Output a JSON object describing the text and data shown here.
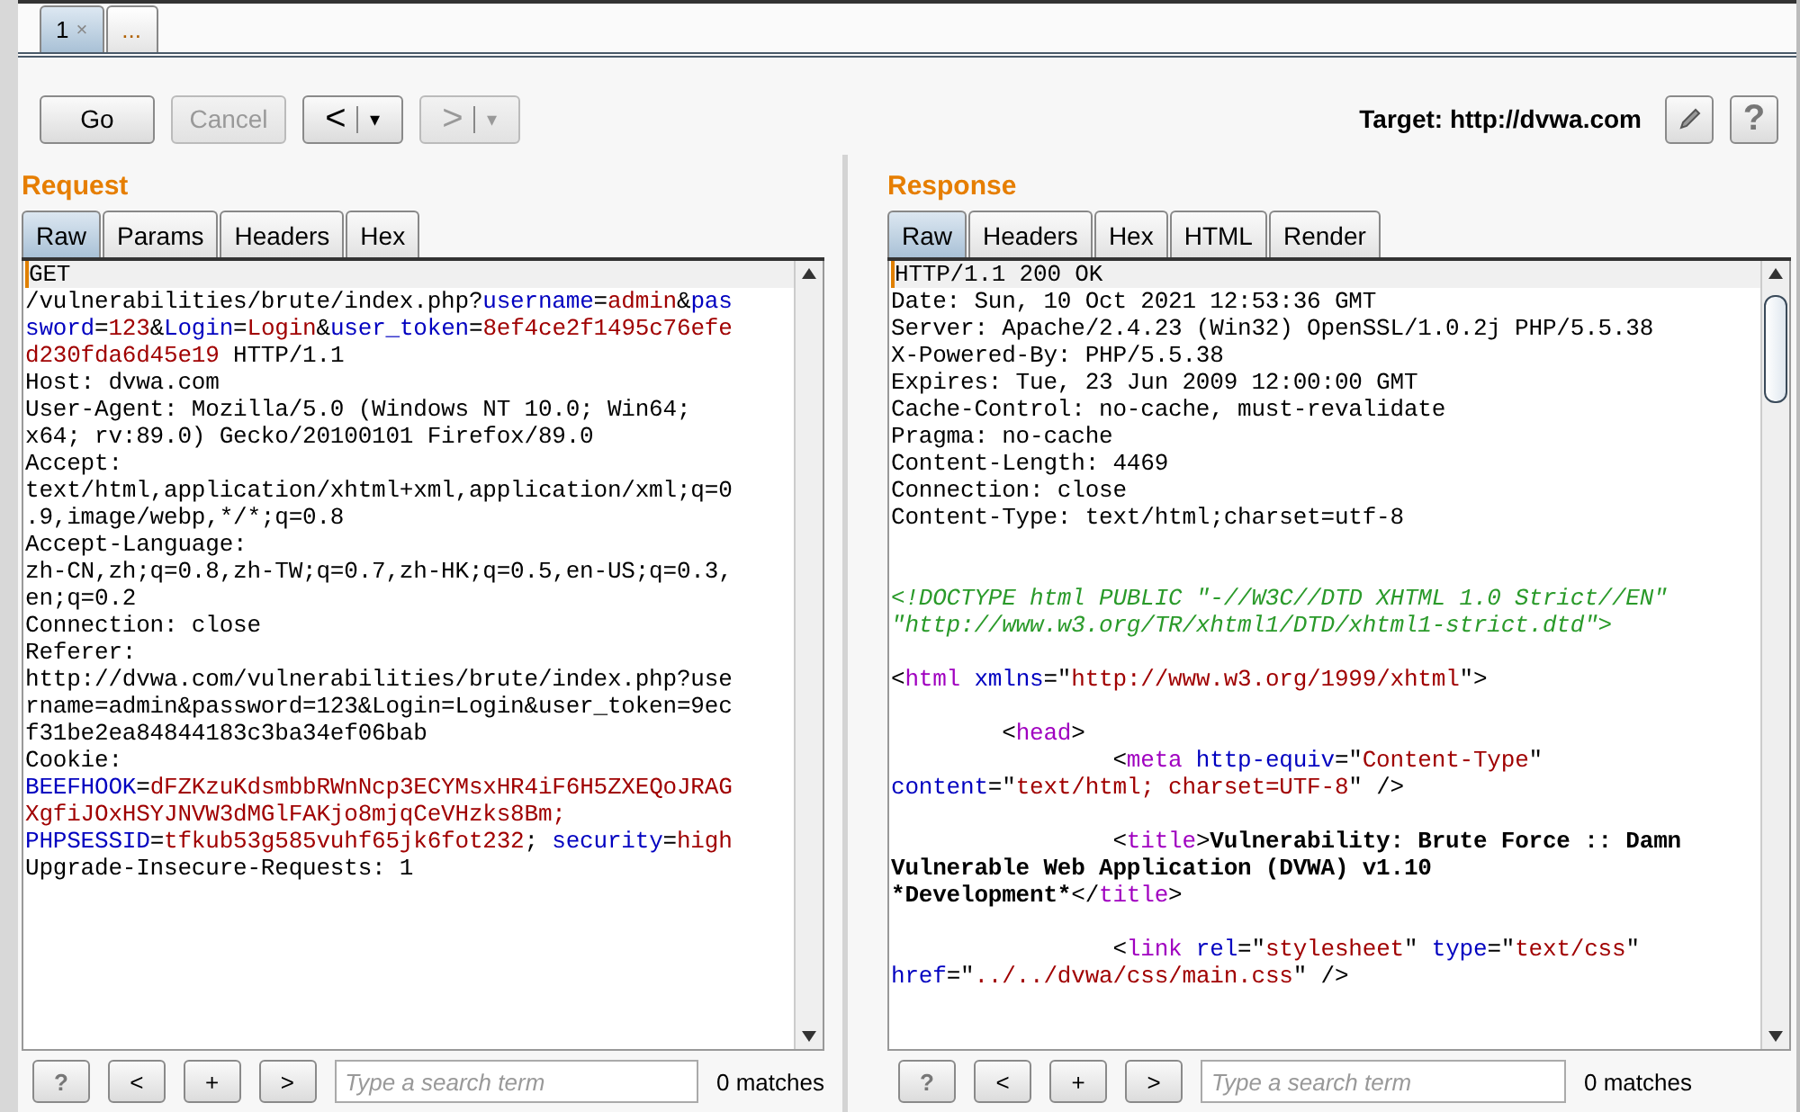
{
  "tabs": [
    {
      "label": "1",
      "close": "×",
      "selected": true
    },
    {
      "label": "...",
      "selected": false
    }
  ],
  "toolbar": {
    "go": "Go",
    "cancel": {
      "label": "Cancel",
      "disabled": true
    },
    "back": {
      "arrow": "<",
      "caret": "▾",
      "disabled": false
    },
    "forward": {
      "arrow": ">",
      "caret": "▾",
      "disabled": true
    },
    "target": "Target: http://dvwa.com",
    "help": "?"
  },
  "request": {
    "title": "Request",
    "tabs": [
      {
        "label": "Raw",
        "selected": true
      },
      {
        "label": "Params",
        "selected": false
      },
      {
        "label": "Headers",
        "selected": false
      },
      {
        "label": "Hex",
        "selected": false
      }
    ],
    "lines": [
      {
        "kind": "code",
        "segments": [
          {
            "text": "GET",
            "kind": "plain"
          }
        ]
      },
      {
        "kind": "code",
        "segments": [
          {
            "text": "/vulnerabilities/brute/index.php?",
            "kind": "plain"
          },
          {
            "text": "username",
            "kind": "key"
          },
          {
            "text": "=",
            "kind": "plain"
          },
          {
            "text": "admin",
            "kind": "value"
          },
          {
            "text": "&",
            "kind": "plain"
          },
          {
            "text": "pas",
            "kind": "key"
          }
        ]
      },
      {
        "kind": "code",
        "segments": [
          {
            "text": "sword",
            "kind": "key"
          },
          {
            "text": "=",
            "kind": "plain"
          },
          {
            "text": "123",
            "kind": "value"
          },
          {
            "text": "&",
            "kind": "plain"
          },
          {
            "text": "Login",
            "kind": "key"
          },
          {
            "text": "=",
            "kind": "plain"
          },
          {
            "text": "Login",
            "kind": "value"
          },
          {
            "text": "&",
            "kind": "plain"
          },
          {
            "text": "user_token",
            "kind": "key"
          },
          {
            "text": "=",
            "kind": "plain"
          },
          {
            "text": "8ef4ce2f1495c76efe",
            "kind": "value"
          }
        ]
      },
      {
        "kind": "code",
        "segments": [
          {
            "text": "d230fda6d45e19",
            "kind": "value"
          },
          {
            "text": " HTTP/1.1",
            "kind": "plain"
          }
        ]
      },
      {
        "kind": "code",
        "segments": [
          {
            "text": "Host: dvwa.com",
            "kind": "plain"
          }
        ]
      },
      {
        "kind": "code",
        "segments": [
          {
            "text": "User-Agent: Mozilla/5.0 (Windows NT 10.0; Win64;",
            "kind": "plain"
          }
        ]
      },
      {
        "kind": "code",
        "segments": [
          {
            "text": "x64; rv:89.0) Gecko/20100101 Firefox/89.0",
            "kind": "plain"
          }
        ]
      },
      {
        "kind": "code",
        "segments": [
          {
            "text": "Accept:",
            "kind": "plain"
          }
        ]
      },
      {
        "kind": "code",
        "segments": [
          {
            "text": "text/html,application/xhtml+xml,application/xml;q=0",
            "kind": "plain"
          }
        ]
      },
      {
        "kind": "code",
        "segments": [
          {
            "text": ".9,image/webp,*/*;q=0.8",
            "kind": "plain"
          }
        ]
      },
      {
        "kind": "code",
        "segments": [
          {
            "text": "Accept-Language:",
            "kind": "plain"
          }
        ]
      },
      {
        "kind": "code",
        "segments": [
          {
            "text": "zh-CN,zh;q=0.8,zh-TW;q=0.7,zh-HK;q=0.5,en-US;q=0.3,",
            "kind": "plain"
          }
        ]
      },
      {
        "kind": "code",
        "segments": [
          {
            "text": "en;q=0.2",
            "kind": "plain"
          }
        ]
      },
      {
        "kind": "code",
        "segments": [
          {
            "text": "Connection: close",
            "kind": "plain"
          }
        ]
      },
      {
        "kind": "code",
        "segments": [
          {
            "text": "Referer:",
            "kind": "plain"
          }
        ]
      },
      {
        "kind": "code",
        "segments": [
          {
            "text": "http://dvwa.com/vulnerabilities/brute/index.php?use",
            "kind": "plain"
          }
        ]
      },
      {
        "kind": "code",
        "segments": [
          {
            "text": "rname=admin&password=123&Login=Login&user_token=9ec",
            "kind": "plain"
          }
        ]
      },
      {
        "kind": "code",
        "segments": [
          {
            "text": "f31be2ea84844183c3ba34ef06bab",
            "kind": "plain"
          }
        ]
      },
      {
        "kind": "code",
        "segments": [
          {
            "text": "Cookie:",
            "kind": "plain"
          }
        ]
      },
      {
        "kind": "code",
        "segments": [
          {
            "text": "BEEFHOOK",
            "kind": "key"
          },
          {
            "text": "=",
            "kind": "plain"
          },
          {
            "text": "dFZKzuKdsmbbRWnNcp3ECYMsxHR4iF6H5ZXEQoJRAG",
            "kind": "value"
          }
        ]
      },
      {
        "kind": "code",
        "segments": [
          {
            "text": "XgfiJOxHSYJNVW3dMGlFAKjo8mjqCeVHzks8Bm;",
            "kind": "value"
          }
        ]
      },
      {
        "kind": "code",
        "segments": [
          {
            "text": "PHPSESSID",
            "kind": "key"
          },
          {
            "text": "=",
            "kind": "plain"
          },
          {
            "text": "tfkub53g585vuhf65jk6fot232",
            "kind": "value"
          },
          {
            "text": "; ",
            "kind": "plain"
          },
          {
            "text": "security",
            "kind": "key"
          },
          {
            "text": "=",
            "kind": "plain"
          },
          {
            "text": "high",
            "kind": "value"
          }
        ]
      },
      {
        "kind": "code",
        "segments": [
          {
            "text": "Upgrade-Insecure-Requests: 1",
            "kind": "plain"
          }
        ]
      }
    ],
    "search": {
      "help": "?",
      "prev": "<",
      "add": "+",
      "next": ">",
      "placeholder": "Type a search term",
      "matches": "0 matches"
    }
  },
  "response": {
    "title": "Response",
    "tabs": [
      {
        "label": "Raw",
        "selected": true
      },
      {
        "label": "Headers",
        "selected": false
      },
      {
        "label": "Hex",
        "selected": false
      },
      {
        "label": "HTML",
        "selected": false
      },
      {
        "label": "Render",
        "selected": false
      }
    ],
    "lines": [
      {
        "kind": "code",
        "segments": [
          {
            "text": "HTTP/1.1 200 OK",
            "kind": "plain"
          }
        ]
      },
      {
        "kind": "code",
        "segments": [
          {
            "text": "Date: Sun, 10 Oct 2021 12:53:36 GMT",
            "kind": "plain"
          }
        ]
      },
      {
        "kind": "code",
        "segments": [
          {
            "text": "Server: Apache/2.4.23 (Win32) OpenSSL/1.0.2j PHP/5.5.38",
            "kind": "plain"
          }
        ]
      },
      {
        "kind": "code",
        "segments": [
          {
            "text": "X-Powered-By: PHP/5.5.38",
            "kind": "plain"
          }
        ]
      },
      {
        "kind": "code",
        "segments": [
          {
            "text": "Expires: Tue, 23 Jun 2009 12:00:00 GMT",
            "kind": "plain"
          }
        ]
      },
      {
        "kind": "code",
        "segments": [
          {
            "text": "Cache-Control: no-cache, must-revalidate",
            "kind": "plain"
          }
        ]
      },
      {
        "kind": "code",
        "segments": [
          {
            "text": "Pragma: no-cache",
            "kind": "plain"
          }
        ]
      },
      {
        "kind": "code",
        "segments": [
          {
            "text": "Content-Length: 4469",
            "kind": "plain"
          }
        ]
      },
      {
        "kind": "code",
        "segments": [
          {
            "text": "Connection: close",
            "kind": "plain"
          }
        ]
      },
      {
        "kind": "code",
        "segments": [
          {
            "text": "Content-Type: text/html;charset=utf-8",
            "kind": "plain"
          }
        ]
      },
      {
        "kind": "blank"
      },
      {
        "kind": "blank"
      },
      {
        "kind": "code",
        "segments": [
          {
            "text": "<!DOCTYPE html PUBLIC \"-//W3C//DTD XHTML 1.0 Strict//EN\"",
            "kind": "doctype"
          }
        ]
      },
      {
        "kind": "code",
        "segments": [
          {
            "text": "\"http://www.w3.org/TR/xhtml1/DTD/xhtml1-strict.dtd\">",
            "kind": "doctype"
          }
        ]
      },
      {
        "kind": "blank"
      },
      {
        "kind": "code",
        "segments": [
          {
            "text": "<",
            "kind": "plain"
          },
          {
            "text": "html",
            "kind": "tag"
          },
          {
            "text": " xmlns",
            "kind": "key"
          },
          {
            "text": "=\"",
            "kind": "plain"
          },
          {
            "text": "http://www.w3.org/1999/xhtml",
            "kind": "value"
          },
          {
            "text": "\">",
            "kind": "plain"
          }
        ]
      },
      {
        "kind": "blank"
      },
      {
        "kind": "code",
        "segments": [
          {
            "text": "        <",
            "kind": "plain"
          },
          {
            "text": "head",
            "kind": "tag"
          },
          {
            "text": ">",
            "kind": "plain"
          }
        ]
      },
      {
        "kind": "code",
        "segments": [
          {
            "text": "                <",
            "kind": "plain"
          },
          {
            "text": "meta",
            "kind": "tag"
          },
          {
            "text": " http-equiv",
            "kind": "key"
          },
          {
            "text": "=\"",
            "kind": "plain"
          },
          {
            "text": "Content-Type",
            "kind": "value"
          },
          {
            "text": "\"",
            "kind": "plain"
          }
        ]
      },
      {
        "kind": "code",
        "segments": [
          {
            "text": "content",
            "kind": "key"
          },
          {
            "text": "=\"",
            "kind": "plain"
          },
          {
            "text": "text/html; charset=UTF-8",
            "kind": "value"
          },
          {
            "text": "\" />",
            "kind": "plain"
          }
        ]
      },
      {
        "kind": "blank"
      },
      {
        "kind": "code",
        "segments": [
          {
            "text": "                <",
            "kind": "plain"
          },
          {
            "text": "title",
            "kind": "tag"
          },
          {
            "text": ">",
            "kind": "plain"
          },
          {
            "text": "Vulnerability: Brute Force :: Damn",
            "kind": "bold"
          }
        ]
      },
      {
        "kind": "code",
        "segments": [
          {
            "text": "Vulnerable Web Application (DVWA) v1.10",
            "kind": "bold"
          }
        ]
      },
      {
        "kind": "code",
        "segments": [
          {
            "text": "*Development*",
            "kind": "bold"
          },
          {
            "text": "</",
            "kind": "plain"
          },
          {
            "text": "title",
            "kind": "tag"
          },
          {
            "text": ">",
            "kind": "plain"
          }
        ]
      },
      {
        "kind": "blank"
      },
      {
        "kind": "code",
        "segments": [
          {
            "text": "                <",
            "kind": "plain"
          },
          {
            "text": "link",
            "kind": "tag"
          },
          {
            "text": " rel",
            "kind": "key"
          },
          {
            "text": "=\"",
            "kind": "plain"
          },
          {
            "text": "stylesheet",
            "kind": "value"
          },
          {
            "text": "\" ",
            "kind": "plain"
          },
          {
            "text": "type",
            "kind": "key"
          },
          {
            "text": "=\"",
            "kind": "plain"
          },
          {
            "text": "text/css",
            "kind": "value"
          },
          {
            "text": "\"",
            "kind": "plain"
          }
        ]
      },
      {
        "kind": "code",
        "segments": [
          {
            "text": "href",
            "kind": "key"
          },
          {
            "text": "=\"",
            "kind": "plain"
          },
          {
            "text": "../../dvwa/css/main.css",
            "kind": "value"
          },
          {
            "text": "\" />",
            "kind": "plain"
          }
        ]
      }
    ],
    "search": {
      "help": "?",
      "prev": "<",
      "add": "+",
      "next": ">",
      "placeholder": "Type a search term",
      "matches": "0 matches"
    }
  }
}
